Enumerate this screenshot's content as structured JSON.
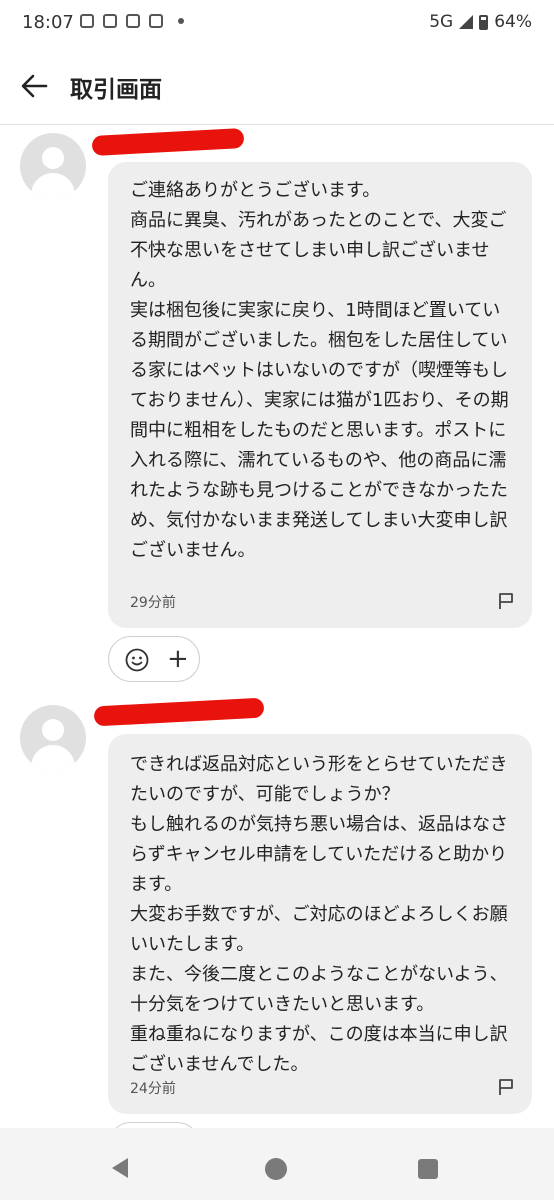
{
  "status_bar": {
    "time": "18:07",
    "network": "5G",
    "battery": "64%"
  },
  "app_bar": {
    "title": "取引画面"
  },
  "messages": [
    {
      "text": "ご連絡ありがとうございます。\n商品に異臭、汚れがあったとのことで、大変ご不快な思いをさせてしまい申し訳ございません。\n実は梱包後に実家に戻り、1時間ほど置いている期間がございました。梱包をした居住している家にはペットはいないのですが（喫煙等もしておりません）、実家には猫が1匹おり、その期間中に粗相をしたものだと思います。ポストに入れる際に、濡れているものや、他の商品に濡れたような跡も見つけることができなかったため、気付かないまま発送してしまい大変申し訳ございません。",
      "time": "29分前"
    },
    {
      "text": "できれば返品対応という形をとらせていただきたいのですが、可能でしょうか？\nもし触れるのが気持ち悪い場合は、返品はなさらずキャンセル申請をしていただけると助かります。\n大変お手数ですが、ご対応のほどよろしくお願いいたします。\nまた、今後二度とこのようなことがないよう、十分気をつけていきたいと思います。\n重ね重ねになりますが、この度は本当に申し訳ございませんでした。",
      "time": "24分前"
    }
  ],
  "colors": {
    "redaction": "#e8130c",
    "bubble": "#eeeeee"
  },
  "icons": {
    "back": "arrow-left-icon",
    "flag": "flag-icon",
    "emoji": "smiley-icon",
    "add": "plus-icon"
  },
  "reaction": {
    "plus_symbol": "+"
  }
}
